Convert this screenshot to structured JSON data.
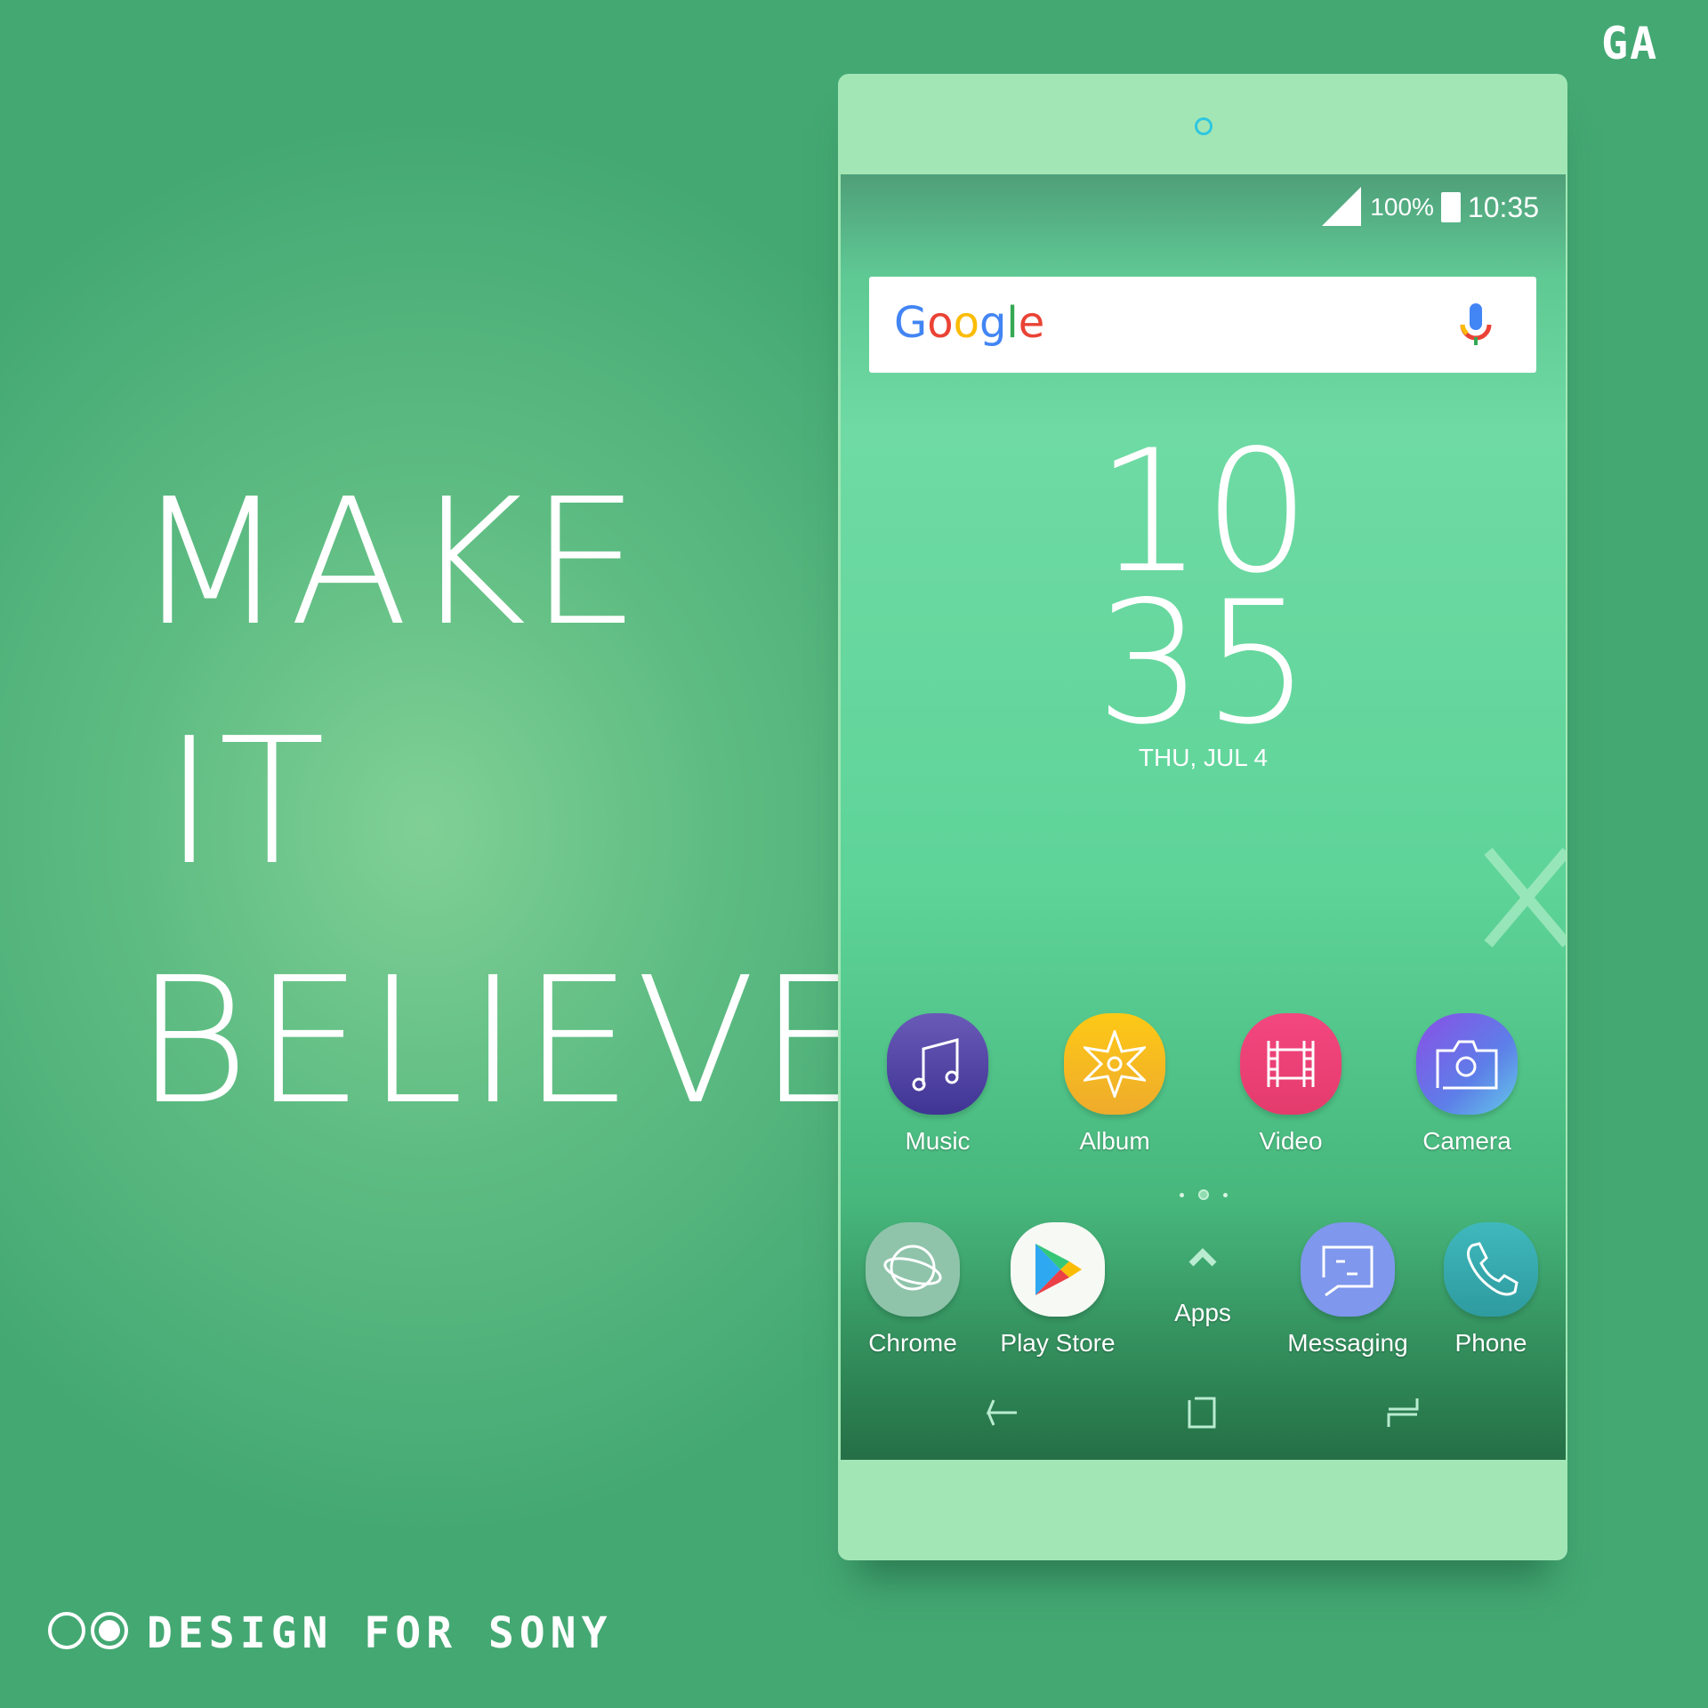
{
  "brand_mark": "GA",
  "slogan": {
    "line1": "MAKE",
    "line2": "IT",
    "line3": "BELIEVE"
  },
  "footer": {
    "text": "DESIGN FOR SONY"
  },
  "status_bar": {
    "battery": "100%",
    "time": "10:35"
  },
  "search": {
    "logo": "Google",
    "mic_icon": "mic-icon"
  },
  "clock": {
    "hour": "10",
    "minute": "35",
    "date": "THU, JUL 4"
  },
  "home_apps": [
    {
      "label": "Music",
      "icon": "music-icon"
    },
    {
      "label": "Album",
      "icon": "album-icon"
    },
    {
      "label": "Video",
      "icon": "video-icon"
    },
    {
      "label": "Camera",
      "icon": "camera-icon"
    }
  ],
  "dock_apps": [
    {
      "label": "Chrome",
      "icon": "browser-icon"
    },
    {
      "label": "Play Store",
      "icon": "play-store-icon"
    },
    {
      "label": "Apps",
      "icon": "chevron-up-icon"
    },
    {
      "label": "Messaging",
      "icon": "message-icon"
    },
    {
      "label": "Phone",
      "icon": "phone-icon"
    }
  ],
  "page_indicator": {
    "pages": 3,
    "current": 2
  },
  "colors": {
    "background": "#44a873",
    "phone_frame": "#a3e6b5",
    "music": "#4f3f9e",
    "album": "#f6b824",
    "video": "#ec4277",
    "camera": "#7a5fe6",
    "chrome": "#8fc4ab",
    "messaging": "#7f97ec",
    "phone": "#34a6a8"
  }
}
